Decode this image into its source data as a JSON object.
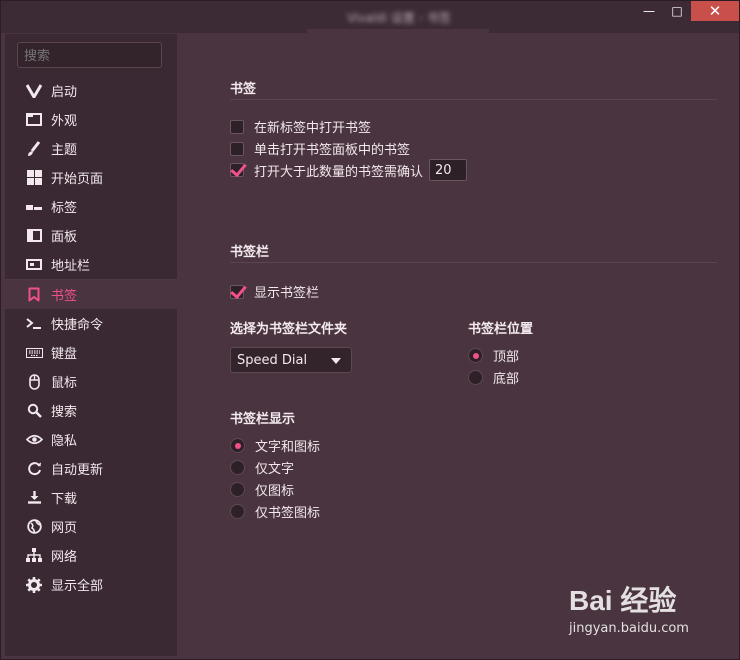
{
  "window": {
    "title": "Vivaldi 设置 - 书签",
    "controls": {
      "minimize": "—",
      "maximize": "□",
      "close": "✕"
    }
  },
  "sidebar": {
    "search_placeholder": "搜索",
    "items": [
      {
        "label": "启动",
        "icon": "vivaldi-logo-icon"
      },
      {
        "label": "外观",
        "icon": "window-icon"
      },
      {
        "label": "主题",
        "icon": "brush-icon"
      },
      {
        "label": "开始页面",
        "icon": "grid-icon"
      },
      {
        "label": "标签",
        "icon": "tabs-icon"
      },
      {
        "label": "面板",
        "icon": "panel-icon"
      },
      {
        "label": "地址栏",
        "icon": "address-bar-icon"
      },
      {
        "label": "书签",
        "icon": "bookmark-icon",
        "active": true
      },
      {
        "label": "快捷命令",
        "icon": "command-prompt-icon"
      },
      {
        "label": "键盘",
        "icon": "keyboard-icon"
      },
      {
        "label": "鼠标",
        "icon": "mouse-icon"
      },
      {
        "label": "搜索",
        "icon": "search-icon"
      },
      {
        "label": "隐私",
        "icon": "eye-icon"
      },
      {
        "label": "自动更新",
        "icon": "refresh-icon"
      },
      {
        "label": "下载",
        "icon": "download-icon"
      },
      {
        "label": "网页",
        "icon": "globe-icon"
      },
      {
        "label": "网络",
        "icon": "network-icon"
      },
      {
        "label": "显示全部",
        "icon": "gear-icon"
      }
    ]
  },
  "bookmarks": {
    "title": "书签",
    "open_in_new_tab": {
      "label": "在新标签中打开书签",
      "checked": false
    },
    "single_click_panel": {
      "label": "单击打开书签面板中的书签",
      "checked": false
    },
    "confirm_open_many": {
      "label": "打开大于此数量的书签需确认",
      "checked": true,
      "value": "20"
    }
  },
  "bookmark_bar": {
    "title": "书签栏",
    "show_bar": {
      "label": "显示书签栏",
      "checked": true
    },
    "folder_label": "选择为书签栏文件夹",
    "folder_value": "Speed Dial",
    "position_label": "书签栏位置",
    "position_options": [
      {
        "label": "顶部",
        "checked": true
      },
      {
        "label": "底部",
        "checked": false
      }
    ],
    "display_label": "书签栏显示",
    "display_options": [
      {
        "label": "文字和图标",
        "checked": true
      },
      {
        "label": "仅文字",
        "checked": false
      },
      {
        "label": "仅图标",
        "checked": false
      },
      {
        "label": "仅书签图标",
        "checked": false
      }
    ]
  },
  "watermark": {
    "brand": "Bai 经验",
    "url": "jingyan.baidu.com"
  },
  "colors": {
    "accent": "#f0518a",
    "background": "#4a3440",
    "sidebar": "#3a2933"
  }
}
